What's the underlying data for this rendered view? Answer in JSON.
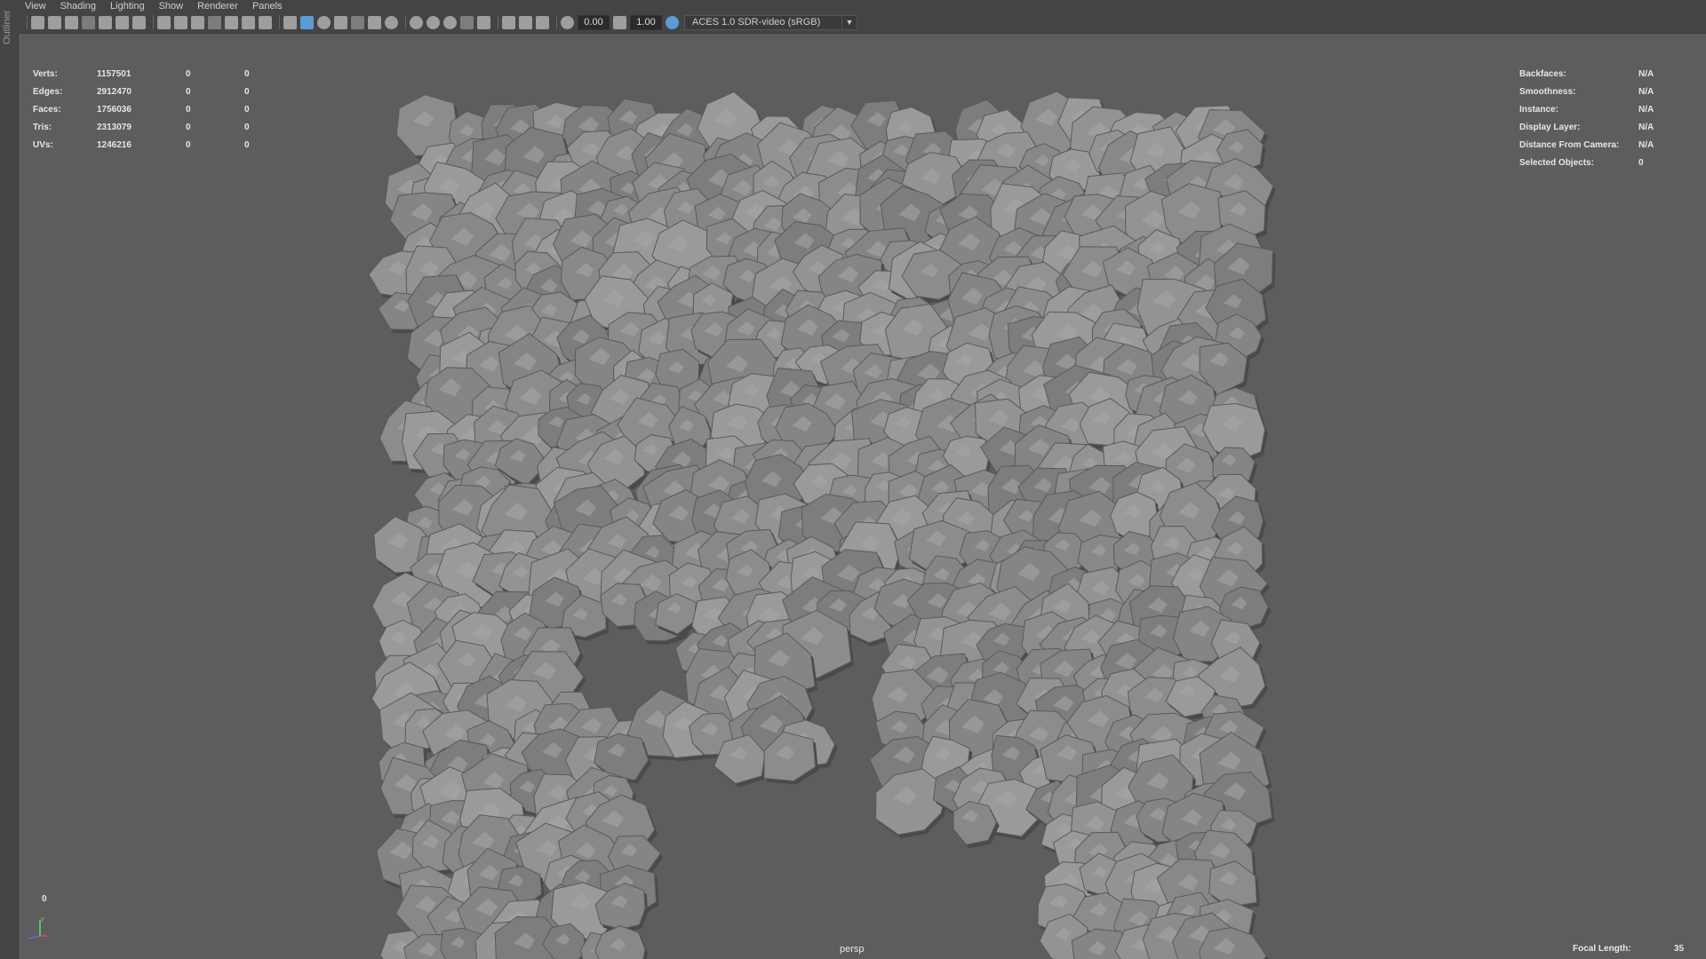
{
  "outliner_label": "Outliner",
  "menu": [
    "View",
    "Shading",
    "Lighting",
    "Show",
    "Renderer",
    "Panels"
  ],
  "toolbar": {
    "exposure_value": "0.00",
    "gamma_value": "1.00",
    "color_space": "ACES 1.0 SDR-video (sRGB)",
    "dropdown_icon": "chevron-down-icon"
  },
  "hud_left": [
    {
      "label": "Verts:",
      "v1": "1157501",
      "v2": "0",
      "v3": "0"
    },
    {
      "label": "Edges:",
      "v1": "2912470",
      "v2": "0",
      "v3": "0"
    },
    {
      "label": "Faces:",
      "v1": "1756036",
      "v2": "0",
      "v3": "0"
    },
    {
      "label": "Tris:",
      "v1": "2313079",
      "v2": "0",
      "v3": "0"
    },
    {
      "label": "UVs:",
      "v1": "1246216",
      "v2": "0",
      "v3": "0"
    }
  ],
  "hud_right": [
    {
      "label": "Backfaces:",
      "value": "N/A"
    },
    {
      "label": "Smoothness:",
      "value": "N/A"
    },
    {
      "label": "Instance:",
      "value": "N/A"
    },
    {
      "label": "Display Layer:",
      "value": "N/A"
    },
    {
      "label": "Distance From Camera:",
      "value": "N/A"
    },
    {
      "label": "Selected Objects:",
      "value": "0"
    }
  ],
  "camera_name": "persp",
  "focal_length_label": "Focal Length:",
  "focal_length_value": "35",
  "frame_indicator": "0",
  "axis_gizmo": {
    "y_label": "y",
    "y_color": "#6fd66f",
    "x_color": "#e05050",
    "z_color": "#5a6fe0"
  },
  "colors": {
    "viewport_bg": "#5d5d5d",
    "panel_bg": "#444444",
    "rock_fill": "#8c8c8c"
  }
}
